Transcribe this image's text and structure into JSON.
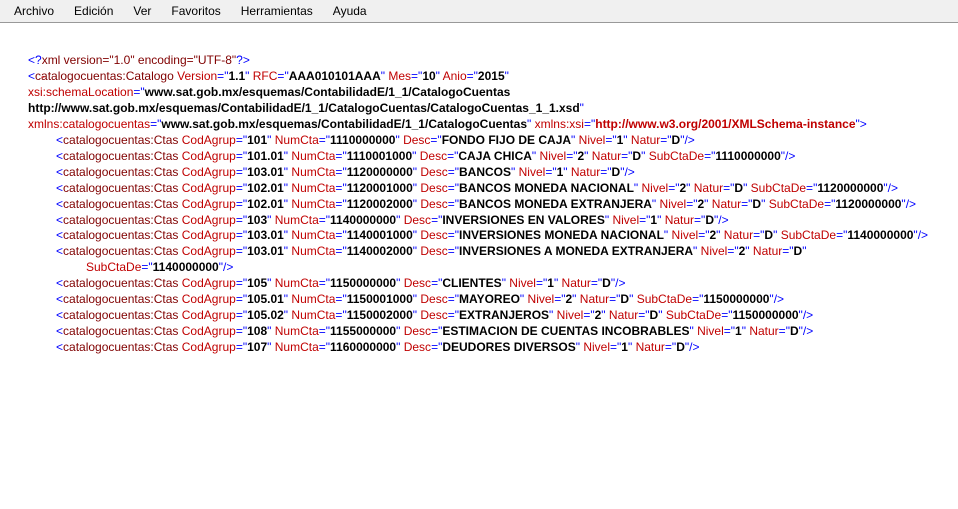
{
  "menu": {
    "archivo": "Archivo",
    "edicion": "Edición",
    "ver": "Ver",
    "favoritos": "Favoritos",
    "herramientas": "Herramientas",
    "ayuda": "Ayuda"
  },
  "xml_decl": "<?xml version=\"1.0\" encoding=\"UTF-8\"?>",
  "root": {
    "tag": "catalogocuentas:Catalogo",
    "attrs": {
      "Version": "1.1",
      "RFC": "AAA010101AAA",
      "Mes": "10",
      "Anio": "2015"
    },
    "schemaLocation_attr": "xsi:schemaLocation",
    "schemaLocation_val": "www.sat.gob.mx/esquemas/ContabilidadE/1_1/CatalogoCuentas http://www.sat.gob.mx/esquemas/ContabilidadE/1_1/CatalogoCuentas/CatalogoCuentas_1_1.xsd",
    "xmlns_cc_attr": "xmlns:catalogocuentas",
    "xmlns_cc_val": "www.sat.gob.mx/esquemas/ContabilidadE/1_1/CatalogoCuentas",
    "xmlns_xsi_attr": "xmlns:xsi",
    "xmlns_xsi_val": "http://www.w3.org/2001/XMLSchema-instance"
  },
  "childTag": "catalogocuentas:Ctas",
  "attrNames": {
    "CodAgrup": "CodAgrup",
    "NumCta": "NumCta",
    "Desc": "Desc",
    "Nivel": "Nivel",
    "Natur": "Natur",
    "SubCtaDe": "SubCtaDe"
  },
  "rows": [
    {
      "CodAgrup": "101",
      "NumCta": "1110000000",
      "Desc": "FONDO FIJO DE CAJA",
      "Nivel": "1",
      "Natur": "D"
    },
    {
      "CodAgrup": "101.01",
      "NumCta": "1110001000",
      "Desc": "CAJA CHICA",
      "Nivel": "2",
      "Natur": "D",
      "SubCtaDe": "1110000000"
    },
    {
      "CodAgrup": "103.01",
      "NumCta": "1120000000",
      "Desc": "BANCOS",
      "Nivel": "1",
      "Natur": "D"
    },
    {
      "CodAgrup": "102.01",
      "NumCta": "1120001000",
      "Desc": "BANCOS MONEDA NACIONAL",
      "Nivel": "2",
      "Natur": "D",
      "SubCtaDe": "1120000000"
    },
    {
      "CodAgrup": "102.01",
      "NumCta": "1120002000",
      "Desc": "BANCOS MONEDA EXTRANJERA",
      "Nivel": "2",
      "Natur": "D",
      "SubCtaDe": "1120000000"
    },
    {
      "CodAgrup": "103",
      "NumCta": "1140000000",
      "Desc": "INVERSIONES EN VALORES",
      "Nivel": "1",
      "Natur": "D"
    },
    {
      "CodAgrup": "103.01",
      "NumCta": "1140001000",
      "Desc": "INVERSIONES MONEDA NACIONAL",
      "Nivel": "2",
      "Natur": "D",
      "SubCtaDe": "1140000000"
    },
    {
      "CodAgrup": "103.01",
      "NumCta": "1140002000",
      "Desc": "INVERSIONES A MONEDA EXTRANJERA",
      "Nivel": "2",
      "Natur": "D",
      "SubCtaDe": "1140000000"
    },
    {
      "CodAgrup": "105",
      "NumCta": "1150000000",
      "Desc": "CLIENTES",
      "Nivel": "1",
      "Natur": "D"
    },
    {
      "CodAgrup": "105.01",
      "NumCta": "1150001000",
      "Desc": "MAYOREO",
      "Nivel": "2",
      "Natur": "D",
      "SubCtaDe": "1150000000"
    },
    {
      "CodAgrup": "105.02",
      "NumCta": "1150002000",
      "Desc": "EXTRANJEROS",
      "Nivel": "2",
      "Natur": "D",
      "SubCtaDe": "1150000000"
    },
    {
      "CodAgrup": "108",
      "NumCta": "1155000000",
      "Desc": "ESTIMACION DE CUENTAS INCOBRABLES",
      "Nivel": "1",
      "Natur": "D"
    },
    {
      "CodAgrup": "107",
      "NumCta": "1160000000",
      "Desc": "DEUDORES DIVERSOS",
      "Nivel": "1",
      "Natur": "D"
    }
  ]
}
